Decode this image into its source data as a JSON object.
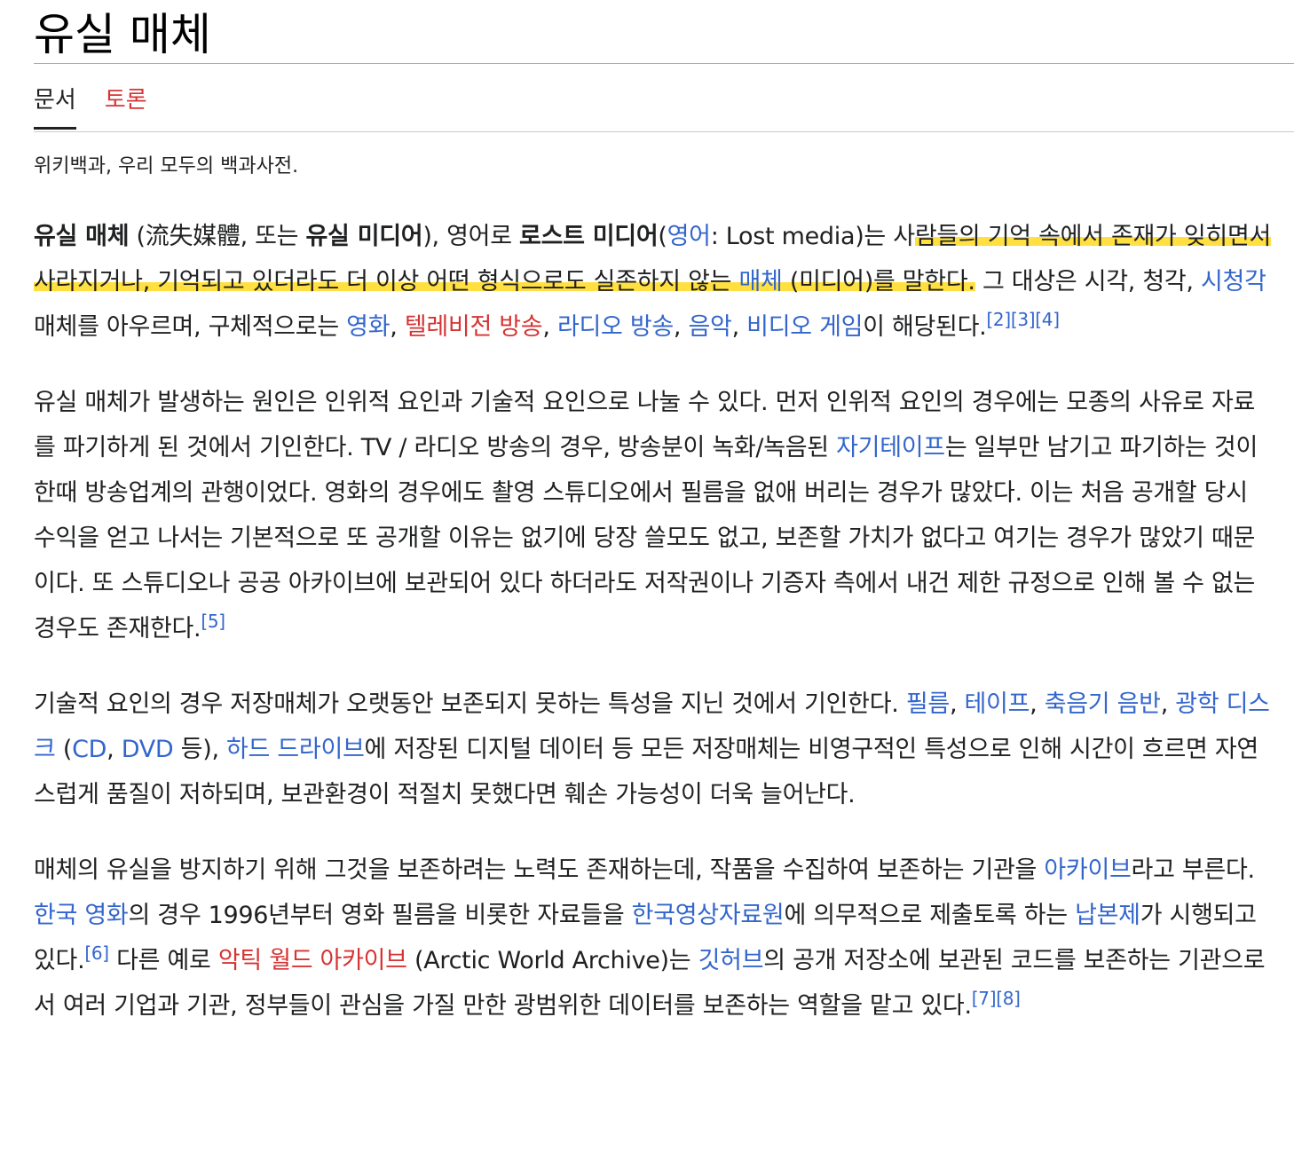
{
  "page": {
    "title": "유실 매체"
  },
  "tabs": [
    {
      "label": "문서",
      "active": true
    },
    {
      "label": "토론",
      "active": false
    }
  ],
  "tagline": "위키백과, 우리 모두의 백과사전.",
  "colors": {
    "link": "#3366cc",
    "new_link": "#d73333",
    "highlight": "#ffd600"
  },
  "p1": {
    "b1": "유실 매체",
    "t1": " (流失媒體, 또는 ",
    "b2": "유실 미디어",
    "t2": "), 영어로 ",
    "b3": "로스트 미디어",
    "t3": "(",
    "lang_link": "영어",
    "t4": ": Lost media)는 사",
    "hl1": "람들의 기억 속에서 존재가 잊히면서 사라지거나, 기억되고 있더라도 더 이상 어떤 형식으로도 실존하지 않는 ",
    "hl_link": "매체",
    "hl2": " (미디어)를 말한다.",
    "t5": " 그 대상은 시각, 청각, ",
    "l_av": "시청각",
    "t6": " 매체를 아우르며, 구체적으로는 ",
    "l_film": "영화",
    "c1": ", ",
    "l_tv": "텔레비전 방송",
    "c2": ", ",
    "l_radio": "라디오 방송",
    "c3": ", ",
    "l_music": "음악",
    "c4": ", ",
    "l_game": "비디오 게임",
    "t7": "이 해당된다.",
    "r2": "[2]",
    "r3": "[3]",
    "r4": "[4]"
  },
  "p2": {
    "t1": "유실 매체가 발생하는 원인은 인위적 요인과 기술적 요인으로 나눌 수 있다. 먼저 인위적 요인의 경우에는 모종의 사유로 자료를 파기하게 된 것에서 기인한다. TV / 라디오 방송의 경우, 방송분이 녹화/녹음된 ",
    "l_tape": "자기테이프",
    "t2": "는 일부만 남기고 파기하는 것이 한때 방송업계의 관행이었다. 영화의 경우에도 촬영 스튜디오에서 필름을 없애 버리는 경우가 많았다. 이는 처음 공개할 당시 수익을 얻고 나서는 기본적으로 또 공개할 이유는 없기에 당장 쓸모도 없고, 보존할 가치가 없다고 여기는 경우가 많았기 때문이다. 또 스튜디오나 공공 아카이브에 보관되어 있다 하더라도 저작권이나 기증자 측에서 내건 제한 규정으로 인해 볼 수 없는 경우도 존재한다.",
    "r5": "[5]"
  },
  "p3": {
    "t1": "기술적 요인의 경우 저장매체가 오랫동안 보존되지 못하는 특성을 지닌 것에서 기인한다. ",
    "l_film": "필름",
    "c1": ", ",
    "l_tape": "테이프",
    "c2": ", ",
    "l_record": "축음기 음반",
    "c3": ", ",
    "l_disc": "광학 디스크",
    "t2": " (",
    "l_cd": "CD",
    "c4": ", ",
    "l_dvd": "DVD",
    "t3": " 등), ",
    "l_hdd": "하드 드라이브",
    "t4": "에 저장된 디지털 데이터 등 모든 저장매체는 비영구적인 특성으로 인해 시간이 흐르면 자연스럽게 품질이 저하되며, 보관환경이 적절치 못했다면 훼손 가능성이 더욱 늘어난다."
  },
  "p4": {
    "t1": "매체의 유실을 방지하기 위해 그것을 보존하려는 노력도 존재하는데, 작품을 수집하여 보존하는 기관을 ",
    "l_archive": "아카이브",
    "t2": "라고 부른다. ",
    "l_kfilm": "한국 영화",
    "t3": "의 경우 1996년부터 영화 필름을 비롯한 자료들을 ",
    "l_kofa": "한국영상자료원",
    "t4": "에 의무적으로 제출토록 하는 ",
    "l_deposit": "납본제",
    "t5": "가 시행되고 있다.",
    "r6": "[6]",
    "t6": " 다른 예로 ",
    "l_arctic": "악틱 월드 아카이브",
    "t7": " (Arctic World Archive)는 ",
    "l_github": "깃허브",
    "t8": "의 공개 저장소에 보관된 코드를 보존하는 기관으로서 여러 기업과 기관, 정부들이 관심을 가질 만한 광범위한 데이터를 보존하는 역할을 맡고 있다.",
    "r7": "[7]",
    "r8": "[8]"
  }
}
